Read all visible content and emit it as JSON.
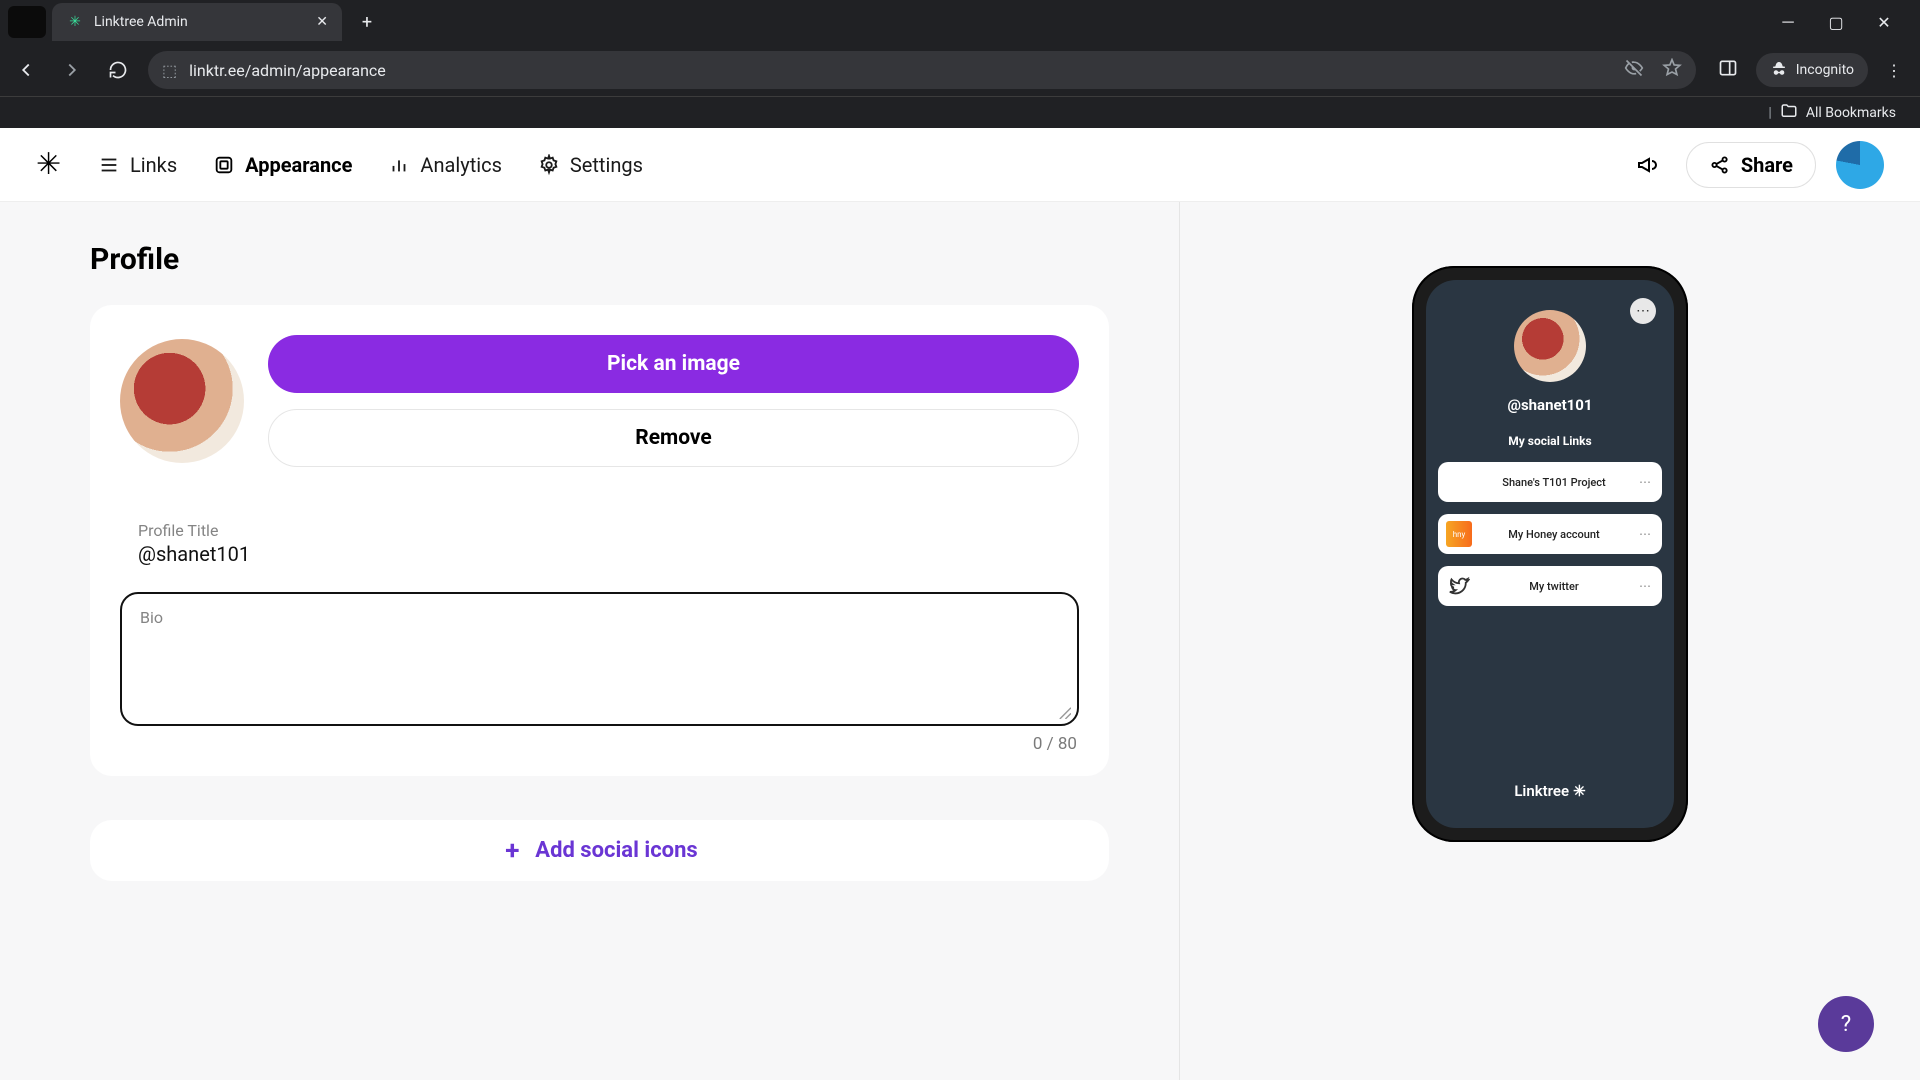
{
  "browser": {
    "tab_title": "Linktree Admin",
    "url": "linktr.ee/admin/appearance",
    "incognito_label": "Incognito",
    "all_bookmarks": "All Bookmarks"
  },
  "nav": {
    "links": "Links",
    "appearance": "Appearance",
    "analytics": "Analytics",
    "settings": "Settings",
    "share": "Share"
  },
  "profile": {
    "section_title": "Profile",
    "pick_image": "Pick an image",
    "remove": "Remove",
    "title_label": "Profile Title",
    "title_value": "@shanet101",
    "bio_label": "Bio",
    "bio_value": "",
    "char_count": "0 / 80",
    "add_social": "Add social icons"
  },
  "preview": {
    "handle": "@shanet101",
    "subtitle": "My social Links",
    "links": [
      {
        "label": "Shane's T101 Project"
      },
      {
        "label": "My Honey account"
      },
      {
        "label": "My twitter"
      }
    ],
    "footer": "Linktree"
  },
  "help_symbol": "?"
}
